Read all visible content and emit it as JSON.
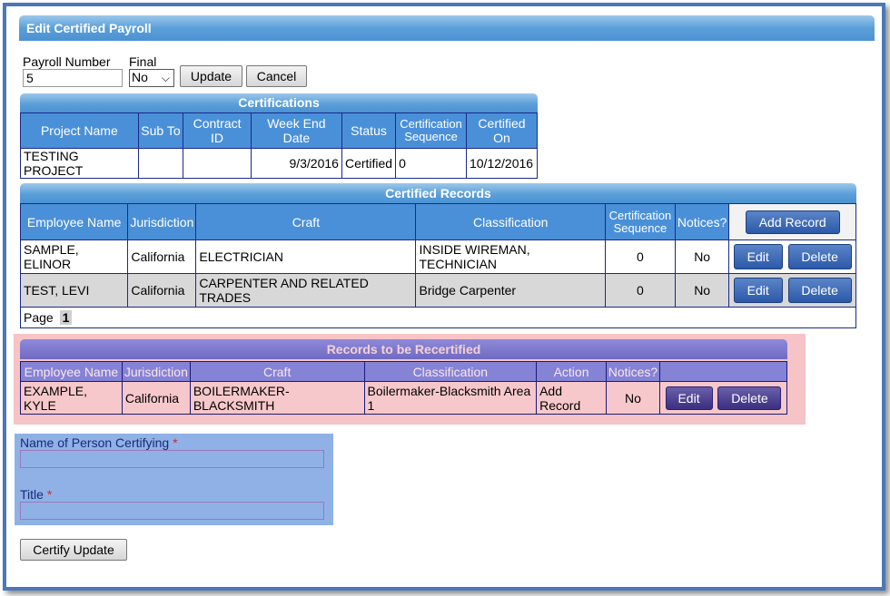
{
  "page": {
    "title": "Edit Certified Payroll"
  },
  "payroll_form": {
    "payroll_number_label": "Payroll Number",
    "payroll_number_value": "5",
    "final_label": "Final",
    "final_value": "No",
    "update_label": "Update",
    "cancel_label": "Cancel"
  },
  "certifications": {
    "title": "Certifications",
    "headers": [
      "Project Name",
      "Sub To",
      "Contract ID",
      "Week End Date",
      "Status",
      "Certification Sequence",
      "Certified On"
    ],
    "rows": [
      [
        "TESTING PROJECT",
        "",
        "",
        "9/3/2016",
        "Certified",
        "0",
        "10/12/2016"
      ]
    ]
  },
  "certified_records": {
    "title": "Certified Records",
    "headers": [
      "Employee Name",
      "Jurisdiction",
      "Craft",
      "Classification",
      "Certification Sequence",
      "Notices?"
    ],
    "add_record_label": "Add Record",
    "edit_label": "Edit",
    "delete_label": "Delete",
    "rows": [
      [
        "SAMPLE, ELINOR",
        "California",
        "ELECTRICIAN",
        "INSIDE WIREMAN, TECHNICIAN",
        "0",
        "No"
      ],
      [
        "TEST, LEVI",
        "California",
        "CARPENTER AND RELATED TRADES",
        "Bridge Carpenter",
        "0",
        "No"
      ]
    ],
    "pager_label": "Page",
    "pager_current": "1"
  },
  "recertify": {
    "title": "Records to be Recertified",
    "headers": [
      "Employee Name",
      "Jurisdiction",
      "Craft",
      "Classification",
      "Action",
      "Notices?"
    ],
    "edit_label": "Edit",
    "delete_label": "Delete",
    "rows": [
      [
        "EXAMPLE, KYLE",
        "California",
        "BOILERMAKER-BLACKSMITH",
        "Boilermaker-Blacksmith Area 1",
        "Add Record",
        "No"
      ]
    ]
  },
  "certify": {
    "name_label": "Name of Person Certifying",
    "title_label": "Title",
    "required_mark": "*",
    "button_label": "Certify Update"
  },
  "colors": {
    "header_blue": "#4b92d2",
    "table_header_blue": "#4a90d9",
    "button_blue": "#2c5aa8",
    "recert_pink": "#f6c3c6",
    "recert_header": "#8583d6",
    "certify_panel": "#8fb1e6"
  }
}
